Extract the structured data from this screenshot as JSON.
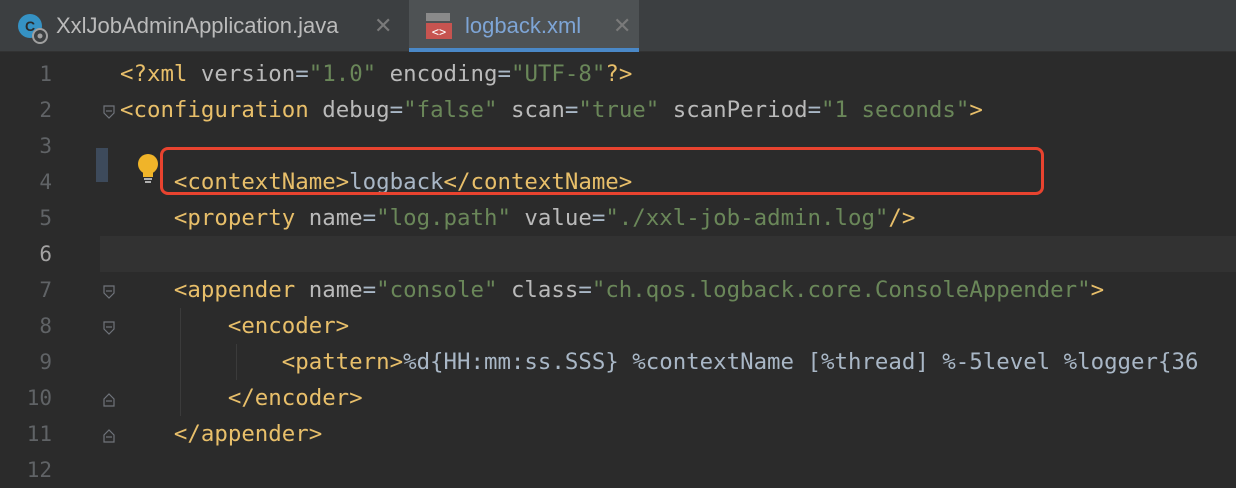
{
  "tabs": [
    {
      "label": "XxlJobAdminApplication.java",
      "active": false,
      "icon": "java-class-icon",
      "close": "✕"
    },
    {
      "label": "logback.xml",
      "active": true,
      "icon": "xml-file-icon",
      "close": "✕"
    }
  ],
  "editor": {
    "line_numbers": [
      "1",
      "2",
      "3",
      "4",
      "5",
      "6",
      "7",
      "8",
      "9",
      "10",
      "11",
      "12"
    ],
    "current_line": "6",
    "lines": [
      {
        "t": [
          [
            "tag",
            "<?xml "
          ],
          [
            "attr",
            "version"
          ],
          [
            "txt",
            "="
          ],
          [
            "val",
            "\"1.0\""
          ],
          [
            "attr",
            " encoding"
          ],
          [
            "txt",
            "="
          ],
          [
            "val",
            "\"UTF-8\""
          ],
          [
            "tag",
            "?>"
          ]
        ]
      },
      {
        "t": [
          [
            "tag",
            "<configuration "
          ],
          [
            "attr",
            "debug"
          ],
          [
            "txt",
            "="
          ],
          [
            "val",
            "\"false\""
          ],
          [
            "attr",
            " scan"
          ],
          [
            "txt",
            "="
          ],
          [
            "val",
            "\"true\""
          ],
          [
            "attr",
            " scanPeriod"
          ],
          [
            "txt",
            "="
          ],
          [
            "val",
            "\"1 seconds\""
          ],
          [
            "tag",
            ">"
          ]
        ]
      },
      {
        "t": []
      },
      {
        "t": [
          [
            "txt",
            "    "
          ],
          [
            "tag",
            "<contextName>"
          ],
          [
            "txt",
            "logback"
          ],
          [
            "tag",
            "</contextName>"
          ]
        ]
      },
      {
        "t": [
          [
            "txt",
            "    "
          ],
          [
            "tag",
            "<property "
          ],
          [
            "attr",
            "name"
          ],
          [
            "txt",
            "="
          ],
          [
            "val",
            "\"log.path\""
          ],
          [
            "attr",
            " value"
          ],
          [
            "txt",
            "="
          ],
          [
            "val",
            "\"./xxl-job-admin.log\""
          ],
          [
            "tag",
            "/>"
          ]
        ]
      },
      {
        "t": []
      },
      {
        "t": [
          [
            "txt",
            "    "
          ],
          [
            "tag",
            "<appender "
          ],
          [
            "attr",
            "name"
          ],
          [
            "txt",
            "="
          ],
          [
            "val",
            "\"console\""
          ],
          [
            "attr",
            " class"
          ],
          [
            "txt",
            "="
          ],
          [
            "val",
            "\"ch.qos.logback.core.ConsoleAppender\""
          ],
          [
            "tag",
            ">"
          ]
        ]
      },
      {
        "t": [
          [
            "txt",
            "        "
          ],
          [
            "tag",
            "<encoder>"
          ]
        ]
      },
      {
        "t": [
          [
            "txt",
            "            "
          ],
          [
            "tag",
            "<pattern>"
          ],
          [
            "txt",
            "%d{HH:mm:ss.SSS} %contextName [%thread] %-5level %logger{36"
          ]
        ]
      },
      {
        "t": [
          [
            "txt",
            "        "
          ],
          [
            "tag",
            "</encoder>"
          ]
        ]
      },
      {
        "t": [
          [
            "txt",
            "    "
          ],
          [
            "tag",
            "</appender>"
          ]
        ]
      },
      {
        "t": []
      }
    ]
  },
  "colors": {
    "background": "#2b2b2b",
    "tag": "#e8bf6a",
    "attribute": "#bababa",
    "value": "#6a8759",
    "text": "#a9b7c6",
    "highlight_box": "#e8432f",
    "active_tab_underline": "#4a88c7"
  },
  "indicators": {
    "intention_bulb": "lightbulb-icon"
  }
}
